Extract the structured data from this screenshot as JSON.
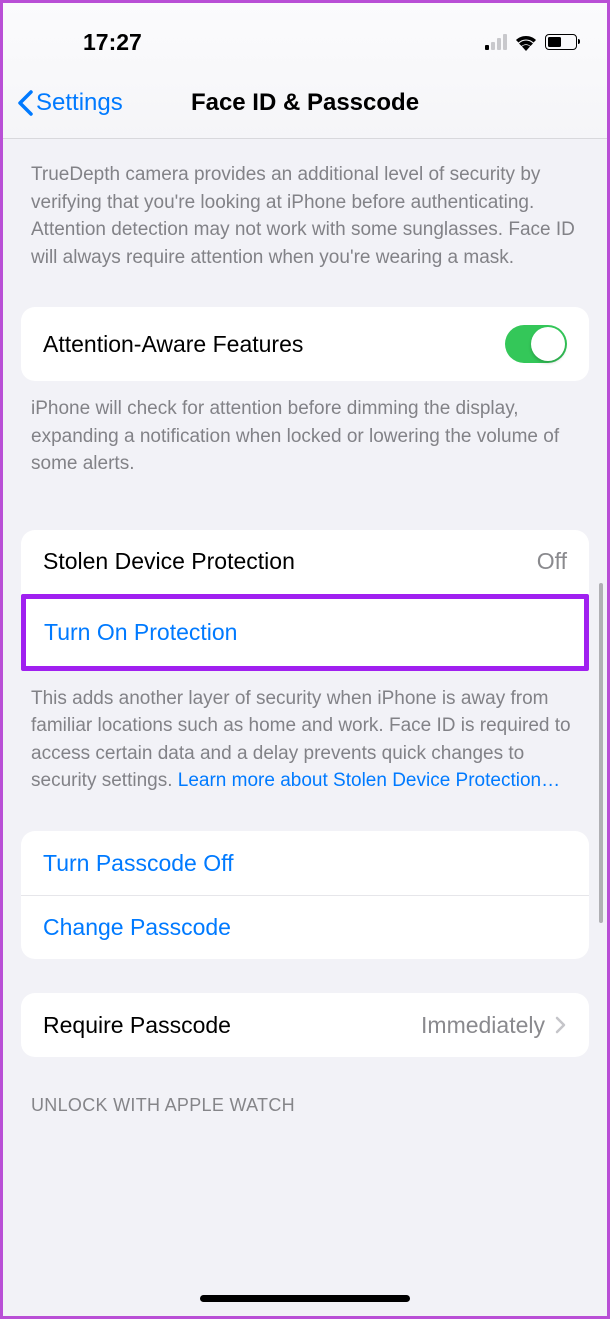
{
  "status": {
    "time": "17:27"
  },
  "nav": {
    "back_label": "Settings",
    "title": "Face ID & Passcode"
  },
  "truedepth_description": "TrueDepth camera provides an additional level of security by verifying that you're looking at iPhone before authenticating. Attention detection may not work with some sunglasses. Face ID will always require attention when you're wearing a mask.",
  "attention_aware": {
    "label": "Attention-Aware Features",
    "description": "iPhone will check for attention before dimming the display, expanding a notification when locked or lowering the volume of some alerts.",
    "enabled": true
  },
  "stolen_device": {
    "label": "Stolen Device Protection",
    "status": "Off",
    "action": "Turn On Protection",
    "description_pre": "This adds another layer of security when iPhone is away from familiar locations such as home and work. Face ID is required to access certain data and a delay prevents quick changes to security settings. ",
    "description_link": "Learn more about Stolen Device Protection…"
  },
  "passcode": {
    "turn_off": "Turn Passcode Off",
    "change": "Change Passcode"
  },
  "require_passcode": {
    "label": "Require Passcode",
    "value": "Immediately"
  },
  "unlock_watch_header": "UNLOCK WITH APPLE WATCH"
}
